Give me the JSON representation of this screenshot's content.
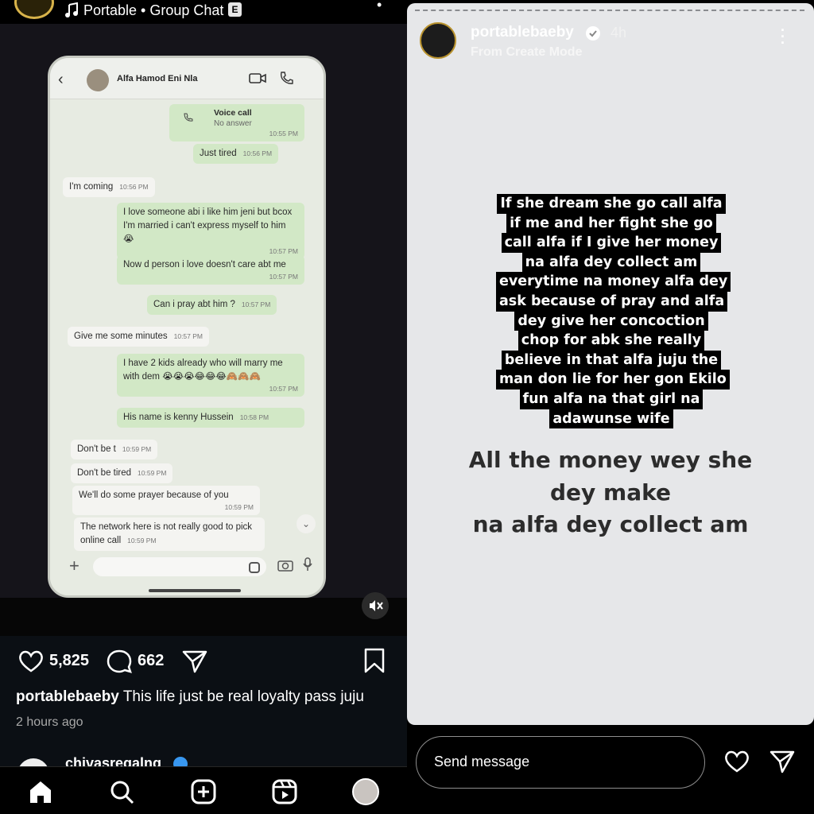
{
  "left_post": {
    "header": {
      "music_label": "Portable • Group Chat",
      "explicit_badge": "E"
    },
    "chat_screenshot": {
      "contact_name": "Alfa Hamod Eni Nla",
      "messages": [
        {
          "dir": "out",
          "text": "Voice call",
          "sub": "No answer",
          "time": "10:55 PM"
        },
        {
          "dir": "out",
          "text": "Just tired",
          "time": "10:56 PM"
        },
        {
          "dir": "in",
          "text": "I'm coming",
          "time": "10:56 PM"
        },
        {
          "dir": "out",
          "text": "I love someone abi i like him jeni but bcox I'm married i can't express myself to him 😭",
          "time": "10:57 PM"
        },
        {
          "dir": "out",
          "text": "Now d person i love doesn't care abt me",
          "time": "10:57 PM"
        },
        {
          "dir": "out",
          "text": "Can i pray abt him ?",
          "time": "10:57 PM"
        },
        {
          "dir": "in",
          "text": "Give me some minutes",
          "time": "10:57 PM"
        },
        {
          "dir": "out",
          "text": "I have 2 kids already who will marry me with dem 😭😭😭😂😂😂🙈🙈🙈",
          "time": "10:57 PM"
        },
        {
          "dir": "out",
          "text": "His name is kenny Hussein",
          "time": "10:58 PM"
        },
        {
          "dir": "in",
          "text": "Don't be t",
          "time": "10:59 PM"
        },
        {
          "dir": "in",
          "text": "Don't be tired",
          "time": "10:59 PM"
        },
        {
          "dir": "in",
          "text": "We'll do some prayer because of you",
          "time": "10:59 PM"
        },
        {
          "dir": "in",
          "text": "The network here is not really good to pick online call",
          "time": "10:59 PM"
        }
      ]
    },
    "actions": {
      "likes": "5,825",
      "comments": "662"
    },
    "caption": {
      "username": "portablebaeby",
      "text": "This life just be real loyalty pass juju"
    },
    "posted_time": "2 hours ago",
    "next_post_user": "chivasregalng",
    "icons": [
      "music-icon",
      "heart-icon",
      "comment-icon",
      "share-icon",
      "bookmark-icon",
      "mute-icon",
      "home-icon",
      "search-icon",
      "create-icon",
      "reels-icon",
      "profile-avatar"
    ]
  },
  "right_story": {
    "username": "portablebaeby",
    "time": "4h",
    "subtitle": "From Create Mode",
    "block_lines": [
      "If she dream she go call alfa",
      "if me and her fight she go",
      "call alfa if I give her money",
      "na alfa dey collect am",
      "everytime na money alfa dey",
      "ask because of pray and alfa",
      "dey give her concoction",
      "chop for abk she really",
      "believe in that alfa juju the",
      "man don lie for her gon Ekilo",
      "fun alfa na that girl na",
      "adawunse wife"
    ],
    "big_lines": [
      "All the money wey she",
      "dey make",
      "na alfa dey collect am"
    ],
    "send_placeholder": "Send message"
  },
  "colors": {
    "background": "#000000",
    "feed_background": "#0b0f14",
    "story_background": "#e6e7e9",
    "verified_blue": "#3897f0",
    "chat_out_bubble": "#d2e8c6"
  }
}
